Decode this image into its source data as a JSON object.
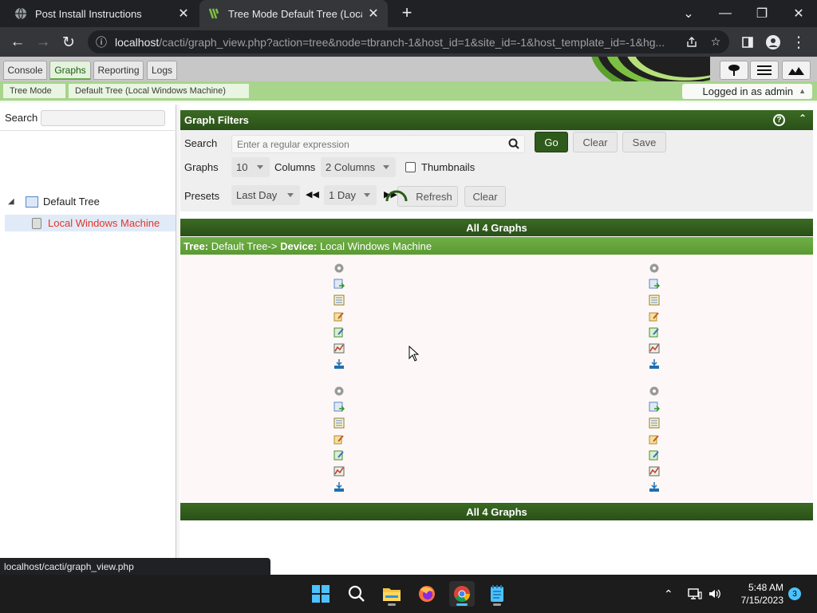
{
  "browser": {
    "tabs": [
      {
        "title": "Post Install Instructions",
        "active": false
      },
      {
        "title": "Tree Mode Default Tree (Local Wi",
        "active": true
      }
    ],
    "new_tab_label": "+",
    "window_controls": {
      "dropdown": "⌄",
      "minimize": "—",
      "restore": "❐",
      "close": "✕"
    },
    "url_host": "localhost",
    "url_path": "/cacti/graph_view.php?action=tree&node=tbranch-1&host_id=1&site_id=-1&host_template_id=-1&hg..."
  },
  "cacti": {
    "nav_tabs": [
      {
        "label": "Console",
        "selected": false
      },
      {
        "label": "Graphs",
        "selected": true
      },
      {
        "label": "Reporting",
        "selected": false
      },
      {
        "label": "Logs",
        "selected": false
      }
    ],
    "breadcrumb": [
      "Tree Mode",
      "Default Tree (Local Windows Machine)"
    ],
    "logged_in": "Logged in as admin"
  },
  "sidebar": {
    "search_label": "Search",
    "search_value": "",
    "tree": {
      "label": "Default Tree",
      "children": [
        {
          "label": "Local Windows Machine",
          "selected": true
        }
      ]
    }
  },
  "filters": {
    "title": "Graph Filters",
    "search_label": "Search",
    "search_placeholder": "Enter a regular expression",
    "go_label": "Go",
    "clear_label": "Clear",
    "save_label": "Save",
    "graphs_label": "Graphs",
    "graphs_value": "10",
    "columns_label": "Columns",
    "columns_value": "2 Columns",
    "thumbnails_label": "Thumbnails",
    "thumbnails_checked": false,
    "presets_label": "Presets",
    "presets_value": "Last Day",
    "timespan_value": "1 Day",
    "refresh_label": "Refresh",
    "clear2_label": "Clear"
  },
  "graphs": {
    "header": "All 4 Graphs",
    "tree_prefix": "Tree:",
    "tree_name": "Default Tree->",
    "device_prefix": "Device:",
    "device_name": "Local Windows Machine",
    "footer": "All 4 Graphs"
  },
  "status_url": "localhost/cacti/graph_view.php",
  "taskbar": {
    "time": "5:48 AM",
    "date": "7/15/2023",
    "notifications": "3"
  },
  "colors": {
    "accent_green": "#2e5a1b",
    "light_green": "#a8d48c",
    "selected_red": "#e5332a"
  }
}
